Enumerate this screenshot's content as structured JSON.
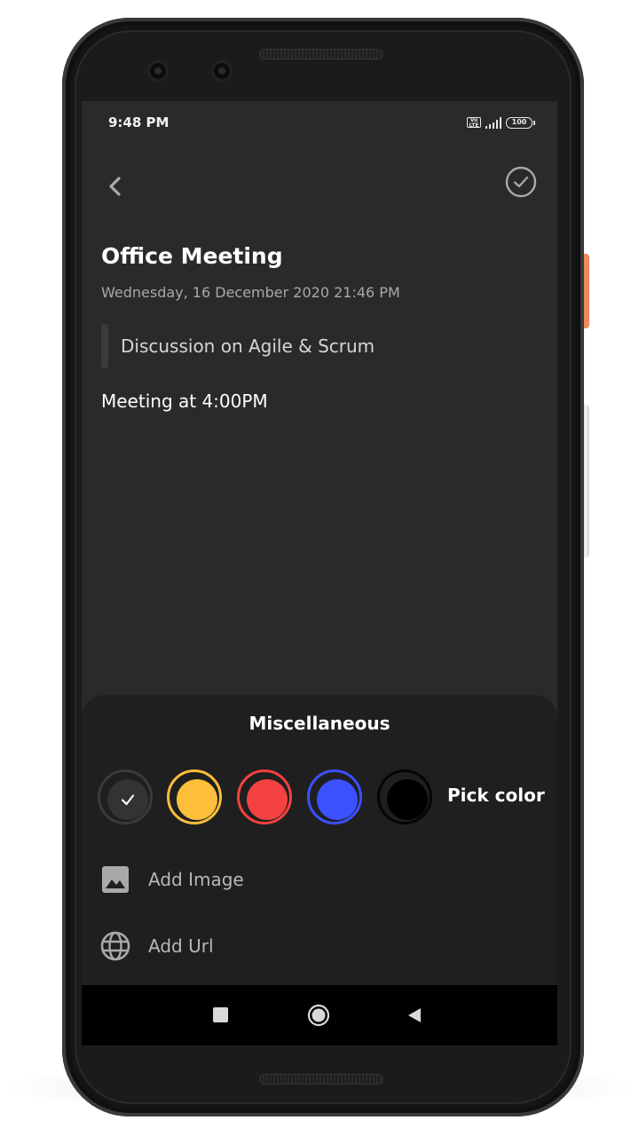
{
  "status_bar": {
    "time": "9:48 PM",
    "volte_label": "Vo LTE",
    "battery": "100"
  },
  "header": {
    "back_icon": "chevron-left-icon",
    "done_icon": "check-circle-icon"
  },
  "note": {
    "title": "Office Meeting",
    "datetime": "Wednesday, 16 December 2020 21:46 PM",
    "subtitle": "Discussion on Agile & Scrum",
    "body": "Meeting at 4:00PM"
  },
  "misc_sheet": {
    "title": "Miscellaneous",
    "colors": [
      {
        "name": "default",
        "hex": "#333333",
        "selected": true
      },
      {
        "name": "yellow",
        "hex": "#fdbe3a",
        "selected": false
      },
      {
        "name": "red",
        "hex": "#f44141",
        "selected": false
      },
      {
        "name": "blue",
        "hex": "#3b50ff",
        "selected": false
      },
      {
        "name": "black",
        "hex": "#000000",
        "selected": false
      }
    ],
    "pick_color_label": "Pick color",
    "actions": [
      {
        "label": "Add Image",
        "icon": "image-icon"
      },
      {
        "label": "Add Url",
        "icon": "globe-icon"
      }
    ]
  },
  "nav_bar": {
    "recents_icon": "square-icon",
    "home_icon": "circle-icon",
    "back_icon": "triangle-back-icon"
  },
  "theme": {
    "background": "#2a2a2a",
    "sheet": "#1f1f1f",
    "text": "#ffffff"
  }
}
